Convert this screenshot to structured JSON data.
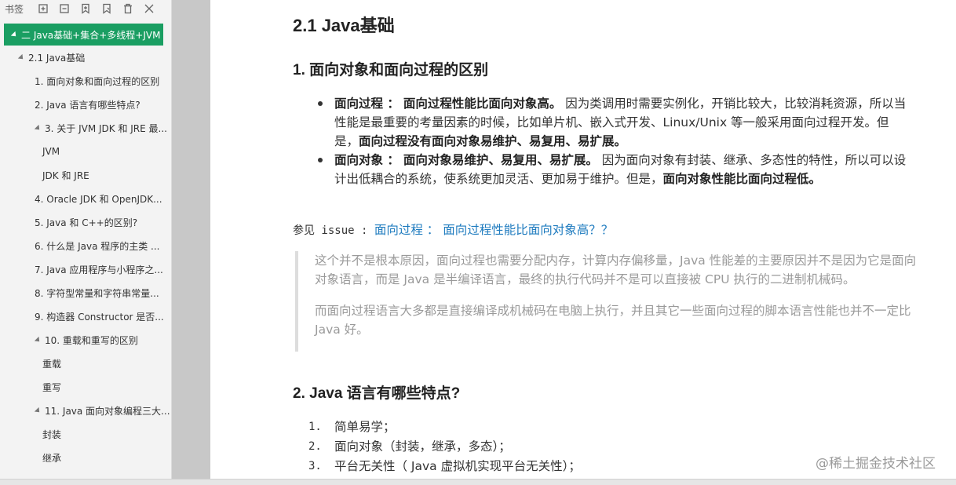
{
  "sidebar": {
    "title": "书签",
    "tree": [
      {
        "label": "二 Java基础+集合+多线程+JVM",
        "level": 0,
        "active": true,
        "expanded": true
      },
      {
        "label": "2.1 Java基础",
        "level": 1,
        "expanded": true
      },
      {
        "label": "1. 面向对象和面向过程的区别",
        "level": 2
      },
      {
        "label": "2. Java 语言有哪些特点?",
        "level": 2
      },
      {
        "label": "3. 关于 JVM JDK 和 JRE 最...",
        "level": 2,
        "expanded": true
      },
      {
        "label": "JVM",
        "level": 3
      },
      {
        "label": "JDK 和 JRE",
        "level": 3
      },
      {
        "label": "4. Oracle JDK 和 OpenJDK...",
        "level": 2
      },
      {
        "label": "5. Java 和 C++的区别?",
        "level": 2
      },
      {
        "label": "6. 什么是 Java 程序的主类 ...",
        "level": 2
      },
      {
        "label": "7. Java 应用程序与小程序之...",
        "level": 2
      },
      {
        "label": "8. 字符型常量和字符串常量...",
        "level": 2
      },
      {
        "label": "9. 构造器 Constructor 是否...",
        "level": 2
      },
      {
        "label": "10. 重载和重写的区别",
        "level": 2,
        "expanded": true
      },
      {
        "label": "重载",
        "level": 3
      },
      {
        "label": "重写",
        "level": 3
      },
      {
        "label": "11. Java 面向对象编程三大...",
        "level": 2,
        "expanded": true
      },
      {
        "label": "封装",
        "level": 3
      },
      {
        "label": "继承",
        "level": 3
      }
    ]
  },
  "doc": {
    "h_java": "2.1 Java基础",
    "h_oop": "1. 面向对象和面向过程的区别",
    "b1_term": "面向过程",
    "b1_sep": " ：",
    "b1_bold": "面向过程性能比面向对象高。",
    "b1_text": " 因为类调用时需要实例化，开销比较大，比较消耗资源，所以当性能是最重要的考量因素的时候，比如单片机、嵌入式开发、Linux/Unix 等一般采用面向过程开发。但是，",
    "b1_bold2": "面向过程没有面向对象易维护、易复用、易扩展。",
    "b2_term": "面向对象",
    "b2_sep": " ：",
    "b2_bold": "面向对象易维护、易复用、易扩展。",
    "b2_text": " 因为面向对象有封装、继承、多态性的特性，所以可以设计出低耦合的系统，使系统更加灵活、更加易于维护。但是，",
    "b2_bold2": "面向对象性能比面向过程低。",
    "see_prefix": "参见 issue : ",
    "see_link": "面向过程 ： 面向过程性能比面向对象高？？",
    "quote1": "这个并不是根本原因，面向过程也需要分配内存，计算内存偏移量，Java 性能差的主要原因并不是因为它是面向对象语言，而是 Java 是半编译语言，最终的执行代码并不是可以直接被 CPU 执行的二进制机械码。",
    "quote2": "而面向过程语言大多都是直接编译成机械码在电脑上执行，并且其它一些面向过程的脚本语言性能也并不一定比 Java 好。",
    "h_features": "2. Java 语言有哪些特点?",
    "list": [
      {
        "num": "1.",
        "text": "简单易学；"
      },
      {
        "num": "2.",
        "text": "面向对象（封装，继承，多态）；"
      },
      {
        "num": "3.",
        "text": "平台无关性（ Java 虚拟机实现平台无关性）；"
      }
    ],
    "watermark": "@稀土掘金技术社区"
  },
  "icons": [
    "add-bookmark-icon",
    "collapse-icon",
    "bookmark-icon",
    "bookmark-outline-icon",
    "delete-icon",
    "close-icon"
  ]
}
